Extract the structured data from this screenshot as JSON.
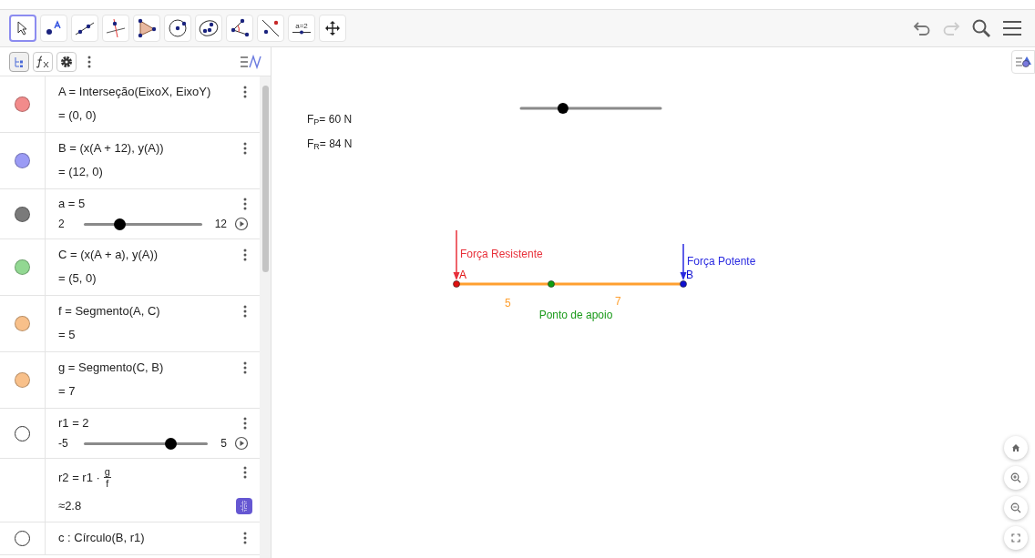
{
  "toolbar": {
    "tools": [
      {
        "kind": "move",
        "selected": true
      },
      {
        "kind": "point",
        "selected": false
      },
      {
        "kind": "line",
        "selected": false
      },
      {
        "kind": "perpendicular",
        "selected": false
      },
      {
        "kind": "polygon",
        "selected": false
      },
      {
        "kind": "circle",
        "selected": false
      },
      {
        "kind": "ellipse",
        "selected": false
      },
      {
        "kind": "angle",
        "selected": false
      },
      {
        "kind": "reflect",
        "selected": false
      },
      {
        "kind": "slider",
        "selected": false,
        "text": "a=2"
      },
      {
        "kind": "move-view",
        "selected": false
      }
    ]
  },
  "algebra": {
    "items": [
      {
        "kind": "expression",
        "visible": true,
        "color": "#f28b8b",
        "definition": "A = Interseção(EixoX, EixoY)",
        "value": "= (0, 0)"
      },
      {
        "kind": "expression",
        "visible": true,
        "color": "#9b9bf5",
        "definition": "B = (x(A + 12), y(A))",
        "value": "= (12, 0)"
      },
      {
        "kind": "slider",
        "visible": true,
        "color": "#7a7a7a",
        "definition": "a = 5",
        "min": "2",
        "max": "12",
        "level": 0.3
      },
      {
        "kind": "expression",
        "visible": true,
        "color": "#92d892",
        "definition": "C = (x(A + a), y(A))",
        "value": "= (5, 0)"
      },
      {
        "kind": "expression",
        "visible": true,
        "color": "#f8c08a",
        "definition": "f = Segmento(A, C)",
        "value": "= 5"
      },
      {
        "kind": "expression",
        "visible": true,
        "color": "#f8c08a",
        "definition": "g = Segmento(C, B)",
        "value": "= 7"
      },
      {
        "kind": "slider",
        "visible": false,
        "definition": "r1 = 2",
        "min": "-5",
        "max": "5",
        "level": 0.7
      },
      {
        "kind": "fraction",
        "definition": "r2 = r1 ·",
        "numerator": "g",
        "denominator": "f",
        "value": "≈2.8"
      },
      {
        "kind": "expression",
        "visible": false,
        "definition": "c : Círculo(B, r1)"
      }
    ]
  },
  "graphics": {
    "texts": [
      "F$_{P}$= 60 N",
      "F$_{R}$= 84 N"
    ],
    "slider": {
      "level": 0.3
    },
    "forces": [
      {
        "label": "Força Resistente",
        "color": "#e8303a"
      },
      {
        "label": "Força Potente",
        "color": "#2a2ae0"
      }
    ],
    "points": [
      {
        "label": "A",
        "color": "#e01010"
      },
      {
        "color": "#10a010"
      },
      {
        "label": "B",
        "color": "#1010d0"
      }
    ],
    "segment_lengths": [
      "5",
      "7"
    ],
    "support_label": "Ponto de apoio"
  }
}
